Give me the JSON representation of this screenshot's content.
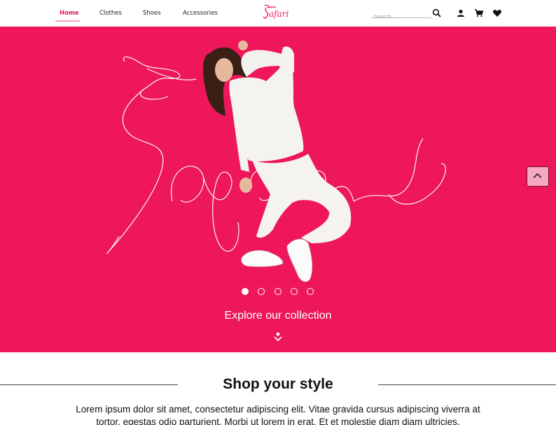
{
  "nav": {
    "links": [
      {
        "label": "Home",
        "active": true
      },
      {
        "label": "Clothes"
      },
      {
        "label": "Shoes"
      },
      {
        "label": "Accessories"
      }
    ],
    "brand_logo_text": "Safari",
    "search": {
      "placeholder": "Search...",
      "value": ""
    },
    "icons": [
      "search-icon",
      "user-icon",
      "cart-icon",
      "heart-icon"
    ]
  },
  "hero": {
    "background_color": "#ee1759",
    "watermark_text": "Safari",
    "carousel": {
      "slides": 5,
      "active_index": 0
    },
    "cta_label": "Explore our collection",
    "icons": [
      "chevron-down-icon",
      "chevron-up-icon"
    ]
  },
  "section": {
    "title": "Shop your style",
    "description": "Lorem ipsum dolor sit amet, consectetur adipiscing elit. Vitae gravida cursus adipiscing viverra at tortor, egestas odio parturient. Morbi ut lorem in erat. Et et molestie diam diam ultricies."
  },
  "colors": {
    "accent": "#e9195e",
    "hero": "#ee1759",
    "up_button": "#f6a8c0"
  }
}
